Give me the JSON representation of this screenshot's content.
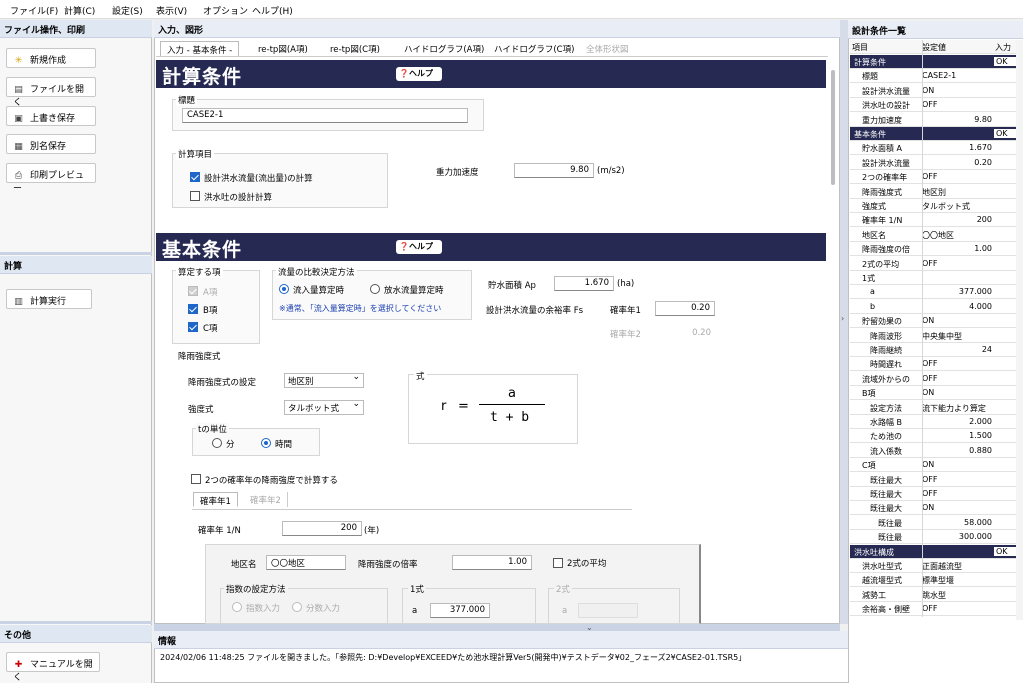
{
  "menu": [
    "ファイル(F)",
    "計算(C)",
    "設定(S)",
    "表示(V)",
    "オプション",
    "ヘルプ(H)"
  ],
  "left": {
    "file_header": "ファイル操作、印刷",
    "buttons": [
      "新規作成",
      "ファイルを開く",
      "上書き保存",
      "別名保存",
      "印刷プレビュー"
    ],
    "calc_header": "計算",
    "calc_button": "計算実行",
    "other_header": "その他",
    "manual_button": "マニュアルを開く"
  },
  "center": {
    "header": "入力、図形",
    "tabs": [
      "入力 - 基本条件 -",
      "re-tp図(A項)",
      "re-tp図(C項)",
      "ハイドログラフ(A項)",
      "ハイドログラフ(C項)",
      "全体形状図"
    ],
    "help": "ヘルプ",
    "calc_section": {
      "title": "計算条件",
      "title_group": "標題",
      "title_value": "CASE2-1",
      "items_group": "計算項目",
      "item1": "設計洪水流量(流出量)の計算",
      "item1_checked": true,
      "item2": "洪水吐の設計計算",
      "item2_checked": false,
      "gravity_label": "重力加速度",
      "gravity_value": "9.80",
      "gravity_unit": "(m/s2)"
    },
    "basic_section": {
      "title": "基本条件",
      "calc_items_group": "算定する項",
      "itemA": "A項",
      "itemB": "B項",
      "itemC": "C項",
      "compare_group": "流量の比較決定方法",
      "opt_inflow": "流入量算定時",
      "opt_outflow": "放水流量算定時",
      "note": "※通常、「流入量算定時」を選択してください",
      "area_label": "貯水面積 Ap",
      "area_value": "1.670",
      "area_unit": "(ha)",
      "margin_label": "設計洪水流量の余裕率 Fs",
      "prob1_label": "確率年1",
      "prob1_value": "0.20",
      "prob2_label": "確率年2",
      "prob2_value": "0.20",
      "rain_group": "降雨強度式",
      "rain_setting_label": "降雨強度式の設定",
      "rain_setting_value": "地区別",
      "intensity_label": "強度式",
      "intensity_value": "タルボット式",
      "formula_label": "式",
      "formula_r": "r",
      "formula_eq": "=",
      "formula_num": "a",
      "formula_den": "t + b",
      "t_unit_group": "tの単位",
      "t_min": "分",
      "t_hour": "時間",
      "two_prob_check": "2つの確率年の降雨強度で計算する",
      "subtab1": "確率年1",
      "subtab2": "確率年2",
      "return_label": "確率年 1/N",
      "return_value": "200",
      "return_unit": "(年)",
      "district_label": "地区名",
      "district_value": "〇〇地区",
      "multiplier_label": "降雨強度の倍率",
      "multiplier_value": "1.00",
      "avg_check": "2式の平均",
      "index_group": "指数の設定方法",
      "idx_input": "指数入力",
      "frac_input": "分数入力",
      "f1_label": "1式",
      "f1_a_label": "a",
      "f1_a_value": "377.000",
      "f2_label": "2式",
      "f2_a_label": "a"
    }
  },
  "info": {
    "header": "情報",
    "message": "2024/02/06 11:48:25 ファイルを開きました。「参照先: D:¥Develop¥EXCEED¥ため池水理計算Ver5(開発中)¥テストデータ¥02_フェーズ2¥CASE2-01.TSR5」"
  },
  "right": {
    "header": "設計条件一覧",
    "col_item": "項目",
    "col_value": "設定値",
    "col_input": "入力",
    "rows": [
      {
        "i": "計算条件",
        "v": "",
        "s": "OK",
        "h": true,
        "d": 0
      },
      {
        "i": "標題",
        "v": "CASE2-1",
        "d": 1
      },
      {
        "i": "設計洪水流量",
        "v": "ON",
        "d": 1
      },
      {
        "i": "洪水吐の設計",
        "v": "OFF",
        "d": 1
      },
      {
        "i": "重力加速度",
        "v": "9.80",
        "d": 1,
        "r": true
      },
      {
        "i": "基本条件",
        "v": "",
        "s": "OK",
        "h": true,
        "d": 0
      },
      {
        "i": "貯水面積 A",
        "v": "1.670",
        "d": 1,
        "r": true
      },
      {
        "i": "設計洪水流量",
        "v": "0.20",
        "d": 1,
        "r": true
      },
      {
        "i": "2つの確率年",
        "v": "OFF",
        "d": 1
      },
      {
        "i": "降雨強度式",
        "v": "地区別",
        "d": 1
      },
      {
        "i": "強度式",
        "v": "タルボット式",
        "d": 1
      },
      {
        "i": "確率年 1/N",
        "v": "200",
        "d": 1,
        "r": true
      },
      {
        "i": "地区名",
        "v": "〇〇地区",
        "d": 1
      },
      {
        "i": "降雨強度の倍",
        "v": "1.00",
        "d": 1,
        "r": true
      },
      {
        "i": "2式の平均",
        "v": "OFF",
        "d": 1
      },
      {
        "i": "1式",
        "v": "",
        "d": 1
      },
      {
        "i": "a",
        "v": "377.000",
        "d": 2,
        "r": true
      },
      {
        "i": "b",
        "v": "4.000",
        "d": 2,
        "r": true
      },
      {
        "i": "貯留効果の",
        "v": "ON",
        "d": 1
      },
      {
        "i": "降雨波形",
        "v": "中央集中型",
        "d": 2
      },
      {
        "i": "降雨継続",
        "v": "24",
        "d": 2,
        "r": true
      },
      {
        "i": "時間遅れ",
        "v": "OFF",
        "d": 2
      },
      {
        "i": "流域外からの",
        "v": "OFF",
        "d": 1
      },
      {
        "i": "B項",
        "v": "ON",
        "d": 1
      },
      {
        "i": "設定方法",
        "v": "流下能力より算定",
        "d": 2
      },
      {
        "i": "水路幅 B",
        "v": "2.000",
        "d": 2,
        "r": true
      },
      {
        "i": "ため池の",
        "v": "1.500",
        "d": 2,
        "r": true
      },
      {
        "i": "流入係数",
        "v": "0.880",
        "d": 2,
        "r": true
      },
      {
        "i": "C項",
        "v": "ON",
        "d": 1
      },
      {
        "i": "既往最大",
        "v": "OFF",
        "d": 2
      },
      {
        "i": "既往最大",
        "v": "OFF",
        "d": 2
      },
      {
        "i": "既往最大",
        "v": "ON",
        "d": 2
      },
      {
        "i": "既往最",
        "v": "58.000",
        "d": 3,
        "r": true
      },
      {
        "i": "既往最",
        "v": "300.000",
        "d": 3,
        "r": true
      },
      {
        "i": "洪水吐構成",
        "v": "",
        "s": "OK",
        "h": true,
        "d": 0
      },
      {
        "i": "洪水吐型式",
        "v": "正面越流型",
        "d": 1
      },
      {
        "i": "越流堰型式",
        "v": "標準型堰",
        "d": 1
      },
      {
        "i": "減勢工",
        "v": "跳水型",
        "d": 1
      },
      {
        "i": "余裕高・側壁",
        "v": "OFF",
        "d": 1
      }
    ]
  }
}
